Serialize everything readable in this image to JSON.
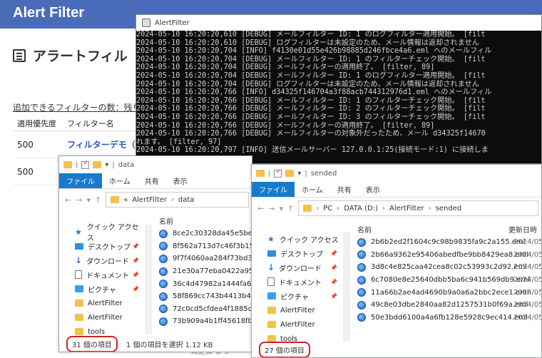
{
  "webapp": {
    "title": "Alert Filter",
    "page_title": "アラートフィル",
    "remaining_label": "追加できるフィルターの数：残り",
    "columns": [
      "適用優先度",
      "フィルター名"
    ],
    "rows": [
      {
        "priority": "500",
        "name": "フィルターデモ（"
      },
      {
        "priority": "500",
        "name": ""
      }
    ],
    "footer_text": "既定値 ま 5"
  },
  "console": {
    "title": "AlertFilter",
    "lines": [
      "2024-05-10 16:20:20,610 [DEBUG] メールフィルター ID: 1 のログフィルター適用開始。 [filt",
      "2024-05-10 16:20:20,610 [DEBUG] ログフィルターは未設定のため、メール情報は返却されません",
      "2024-05-10 16:20:20,704 [INFO] f4130e01d55e426b98885d246fbce4a6.eml へのメールフィル",
      "2024-05-10 16:20:20,704 [DEBUG] メールフィルター ID: 1 のフィルターチェック開始。 [filt",
      "2024-05-10 16:20:20,704 [DEBUG] メールフィルターの適用終了。 [filter, 89]",
      "2024-05-10 16:20:20,704 [DEBUG] メールフィルター ID: 1 のログフィルター適用開始。 [filt",
      "2024-05-10 16:20:20,704 [DEBUG] ログフィルターは未設定のため、メール情報は返却されません",
      "2024-05-10 16:20:20,766 [INFO] d34325f146704a3f88acb744312976d1.eml へのメールフィル",
      "2024-05-10 16:20:20,766 [DEBUG] メールフィルター ID: 1 のフィルターチェック開始。 [filt",
      "2024-05-10 16:20:20,766 [DEBUG] メールフィルター ID: 2 のフィルターチェック開始。 [filt",
      "2024-05-10 16:20:20,766 [DEBUG] メールフィルター ID: 3 のフィルターチェック開始。 [filt",
      "2024-05-10 16:20:20,766 [DEBUG] メールフィルターの適用終了。 [filter, 89]",
      "2024-05-10 16:20:20,766 [DEBUG] メールフィルターの対象外だったため、メール d34325f14670",
      "れます。 [filter, 97]",
      "2024-05-10 16:20:20,797 [INFO] 送信メールサーバー 127.0.0.1:25(接続モード:1) に接続しま"
    ]
  },
  "explorer_data": {
    "window_title": "data",
    "ribbon_tabs": [
      "ファイル",
      "ホーム",
      "共有",
      "表示"
    ],
    "breadcrumb": [
      "«",
      "AlertFilter",
      "data"
    ],
    "nav_items": [
      {
        "icon": "star-icon",
        "label": "クイック アクセス"
      },
      {
        "icon": "desktop-icon",
        "label": "デスクトップ"
      },
      {
        "icon": "download-icon",
        "label": "ダウンロード"
      },
      {
        "icon": "documents-icon",
        "label": "ドキュメント"
      },
      {
        "icon": "pictures-icon",
        "label": "ピクチャ"
      },
      {
        "icon": "folder-icon",
        "label": "AlertFilter"
      },
      {
        "icon": "folder-icon",
        "label": "AlertFilter"
      },
      {
        "icon": "folder-icon",
        "label": "tools"
      }
    ],
    "column_name": "名前",
    "files": [
      "8ce2c30328da45e5bedccf",
      "8f562a713d7c46f3b15b3d",
      "9f7f4060aa284f73bd3ab0",
      "21e30a77eba0422a95868e",
      "36c4d47982a1444fa63b56",
      "58f869cc743b4413b420b2",
      "72c0cd5cfdea4f1885da9d",
      "73b909a4b1ff45618fba71"
    ],
    "status_count": "31 個の項目",
    "status_selected": "1 個の項目を選択 1.12 KB"
  },
  "explorer_sended": {
    "window_title": "sended",
    "ribbon_tabs": [
      "ファイル",
      "ホーム",
      "共有",
      "表示"
    ],
    "breadcrumb": [
      "PC",
      "DATA (D:)",
      "AlertFilter",
      "sended"
    ],
    "nav_items": [
      {
        "icon": "star-icon",
        "label": "クイック アクセス"
      },
      {
        "icon": "desktop-icon",
        "label": "デスクトップ"
      },
      {
        "icon": "download-icon",
        "label": "ダウンロード"
      },
      {
        "icon": "documents-icon",
        "label": "ドキュメント"
      },
      {
        "icon": "pictures-icon",
        "label": "ピクチャ"
      },
      {
        "icon": "folder-icon",
        "label": "AlertFilter"
      },
      {
        "icon": "folder-icon",
        "label": "AlertFilter"
      },
      {
        "icon": "folder-icon",
        "label": "tools"
      }
    ],
    "column_name": "名前",
    "column_date": "更新日時",
    "files": [
      {
        "name": "2b6b2ed2f1604c9c98b9835fa9c2a155.eml",
        "date": "2024/05/1"
      },
      {
        "name": "2b66a9362e95406abedfbe9bb8429ea8.eml",
        "date": "2024/05/1"
      },
      {
        "name": "3d8c4e825caa42cea8c02c53993c2d92.eml",
        "date": "2024/05/1"
      },
      {
        "name": "6c7080e8e25640dbb5ba6c941b569db9.eml",
        "date": "2024/05/1"
      },
      {
        "name": "11a66b2ae4ad4690b9a0a6a2bbc2ece1.eml",
        "date": "2024/05/1"
      },
      {
        "name": "49c8e03dbe2840aa82d1257531b0f69a.eml",
        "date": "2024/05/1"
      },
      {
        "name": "50e3bdd6100a4a6fb128e5928c9ec414.eml",
        "date": "2024/05/1"
      }
    ],
    "status_count": "27 個の項目"
  },
  "colors": {
    "accent": "#4a6bb8",
    "ribbon_active": "#1979ca",
    "highlight_box": "#cc2222",
    "console_bg": "#0c0c0c"
  }
}
